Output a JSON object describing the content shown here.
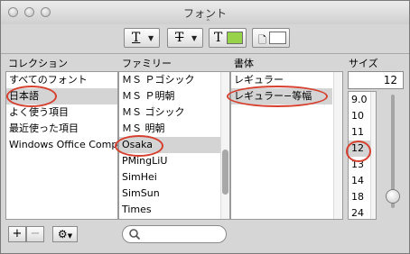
{
  "window": {
    "title": "フォント"
  },
  "toolbar": {
    "underline_glyph": "T",
    "strike_glyph": "T",
    "text_color_glyph": "T",
    "text_color_swatch": "#98d24a",
    "doc_color_swatch": "#ffffff"
  },
  "columns": {
    "collection": {
      "header": "コレクション",
      "items": [
        "すべてのフォント",
        "日本語",
        "よく使う項目",
        "最近使った項目",
        "Windows Office Compatible"
      ],
      "selected": "日本語"
    },
    "family": {
      "header": "ファミリー",
      "items": [
        "ＭＳ Ｐゴシック",
        "ＭＳ Ｐ明朝",
        "ＭＳ ゴシック",
        "ＭＳ 明朝",
        "Osaka",
        "PMingLiU",
        "SimHei",
        "SimSun",
        "Times"
      ],
      "selected": "Osaka"
    },
    "typeface": {
      "header": "書体",
      "items": [
        "レギュラー",
        "レギュラー−等幅"
      ],
      "selected": "レギュラー−等幅"
    },
    "size": {
      "header": "サイズ",
      "value": "12",
      "items": [
        "9.0",
        "10",
        "11",
        "12",
        "13",
        "14",
        "18",
        "24"
      ],
      "selected": "12",
      "slider_level": 0.95
    }
  },
  "bottom": {
    "add": "+",
    "remove": "−",
    "action_icon": "gear-icon",
    "search_placeholder": ""
  },
  "highlight_color": "#d6402f"
}
